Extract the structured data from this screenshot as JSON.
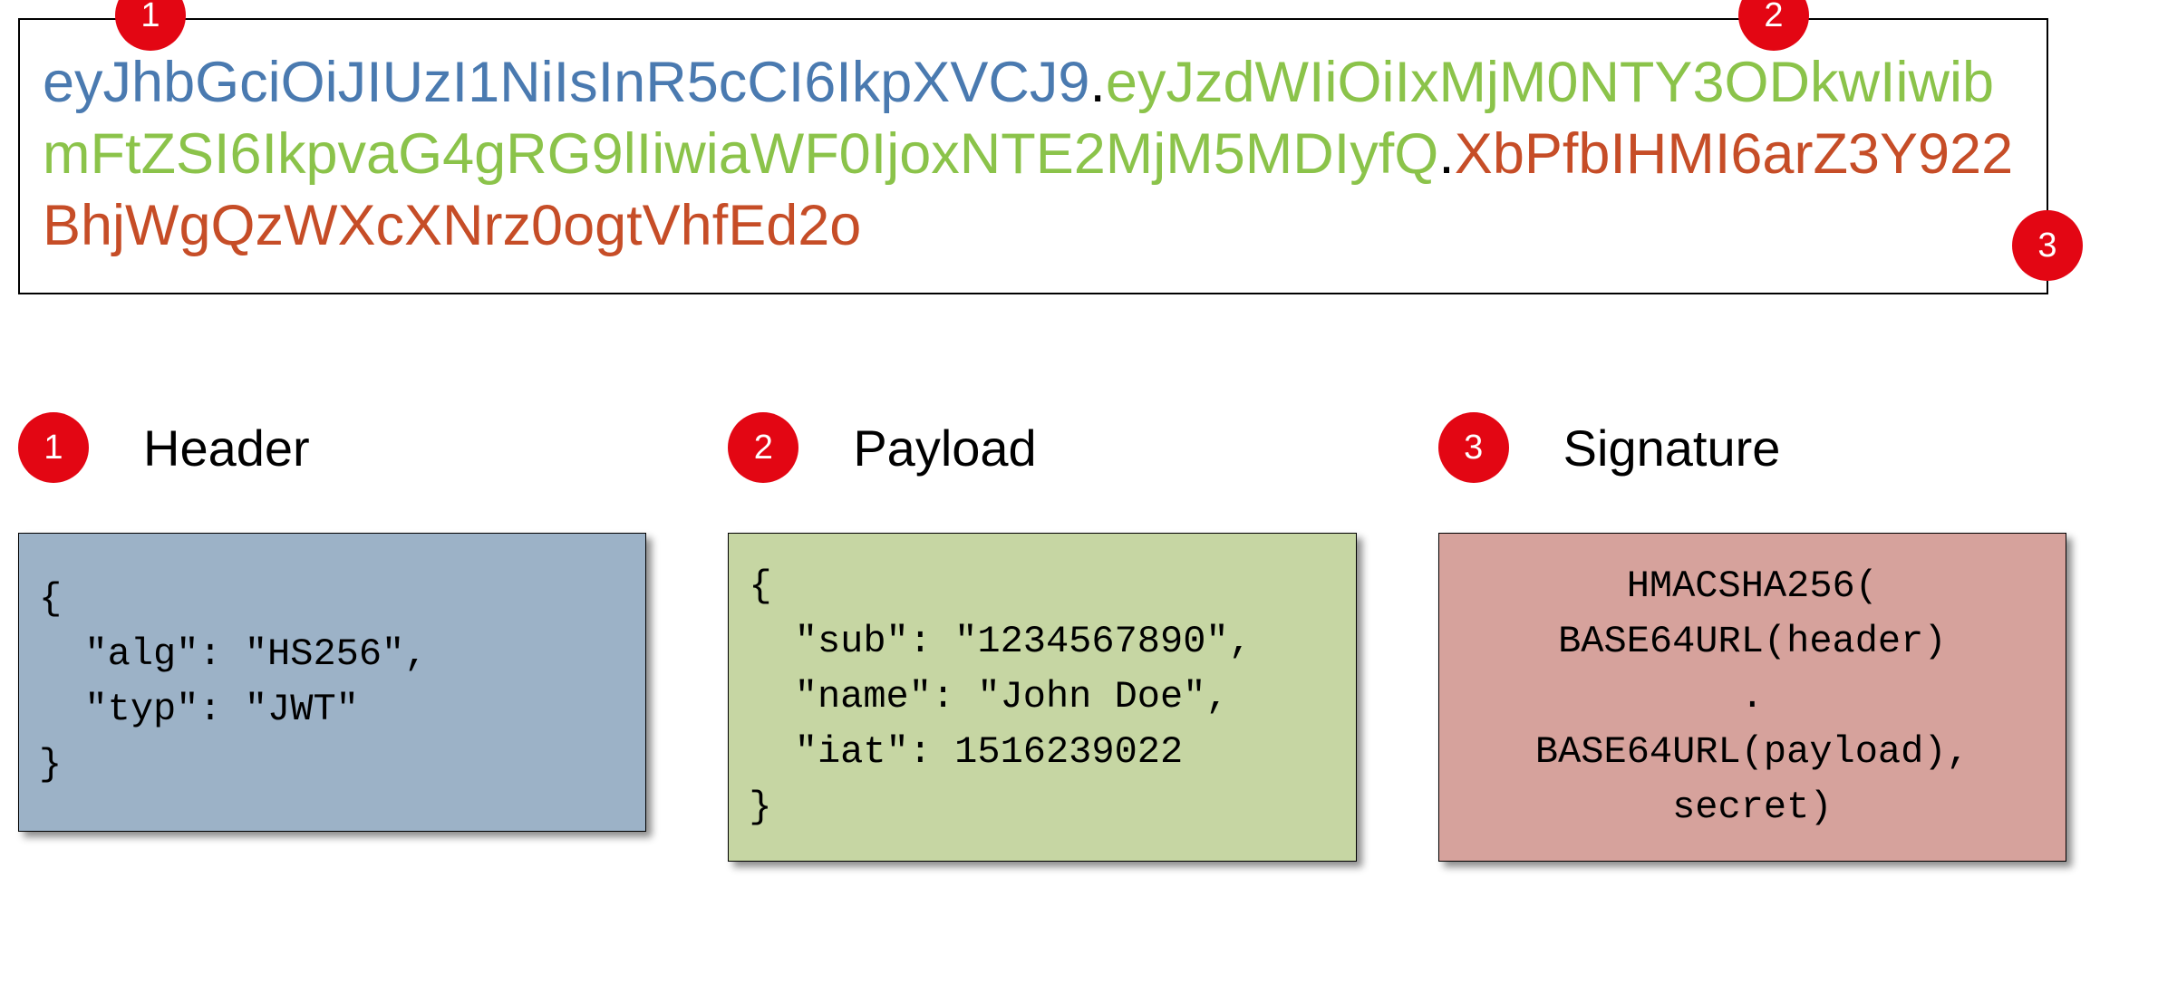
{
  "token": {
    "header_b64": "eyJhbGciOiJIUzI1NiIsInR5cCI6IkpXVCJ9",
    "payload_b64": "eyJzdWIiOiIxMjM0NTY3ODkwIiwibmFtZSI6IkpvaG4gRG9lIiwiaWF0IjoxNTE2MjM5MDIyfQ",
    "signature": "XbPfbIHMI6arZ3Y922BhjWgQzWXcXNrz0ogtVhfEd2o",
    "separator": "."
  },
  "badges": {
    "top1": "1",
    "top2": "2",
    "top3": "3"
  },
  "sections": {
    "header": {
      "badge": "1",
      "title": "Header",
      "code": "{\n  \"alg\": \"HS256\",\n  \"typ\": \"JWT\"\n}"
    },
    "payload": {
      "badge": "2",
      "title": "Payload",
      "code": "{\n  \"sub\": \"1234567890\",\n  \"name\": \"John Doe\",\n  \"iat\": 1516239022\n}"
    },
    "signature": {
      "badge": "3",
      "title": "Signature",
      "code": "HMACSHA256(\nBASE64URL(header)\n.\nBASE64URL(payload),\nsecret)"
    }
  }
}
